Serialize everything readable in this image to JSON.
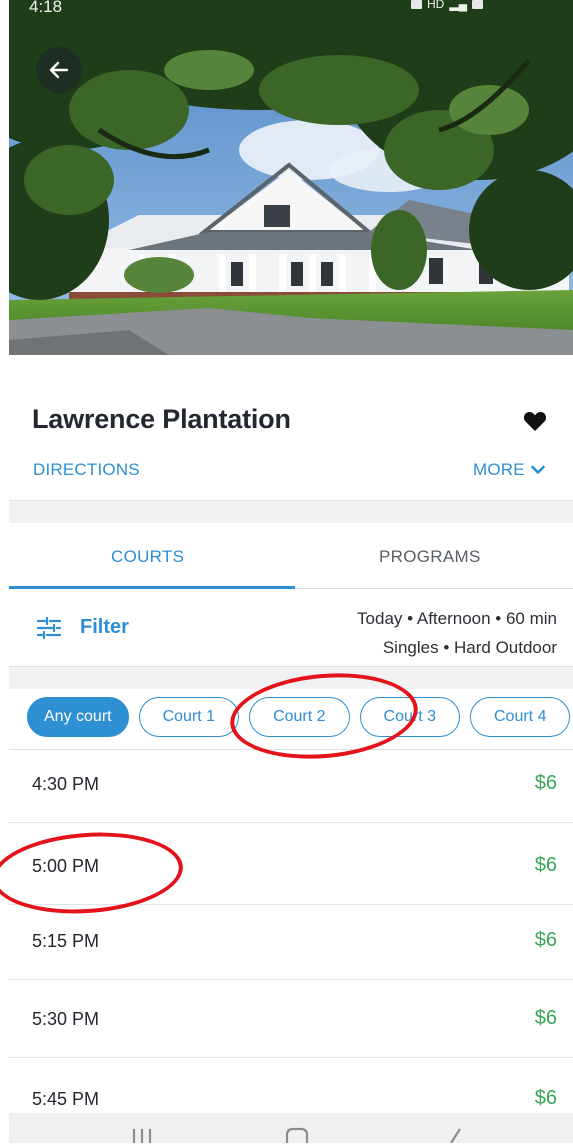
{
  "status_bar": {
    "time": "4:18",
    "signal": "HD"
  },
  "venue": {
    "name": "Lawrence Plantation",
    "directions_label": "DIRECTIONS",
    "more_label": "MORE"
  },
  "tabs": [
    {
      "label": "COURTS",
      "active": true
    },
    {
      "label": "PROGRAMS",
      "active": false
    }
  ],
  "filter": {
    "label": "Filter",
    "summary_line1": "Today • Afternoon • 60 min",
    "summary_line2": "Singles • Hard Outdoor"
  },
  "court_chips": [
    {
      "label": "Any court",
      "selected": true
    },
    {
      "label": "Court 1",
      "selected": false
    },
    {
      "label": "Court 2",
      "selected": false
    },
    {
      "label": "Court 3",
      "selected": false
    },
    {
      "label": "Court 4",
      "selected": false
    }
  ],
  "time_slots": [
    {
      "time": "4:30 PM",
      "price": "$6"
    },
    {
      "time": "5:00 PM",
      "price": "$6"
    },
    {
      "time": "5:15 PM",
      "price": "$6"
    },
    {
      "time": "5:30 PM",
      "price": "$6"
    },
    {
      "time": "5:45 PM",
      "price": "$6"
    }
  ],
  "colors": {
    "accent": "#2e8fd3",
    "price": "#3aa65a",
    "annotation": "#e3121b",
    "title": "#23272f"
  },
  "icons": {
    "back": "arrow-left-icon",
    "favorite": "heart-icon",
    "more": "chevron-down-icon",
    "filter": "sliders-icon",
    "nav_recent": "recent-apps-icon",
    "nav_home": "home-icon",
    "nav_back": "back-icon"
  }
}
